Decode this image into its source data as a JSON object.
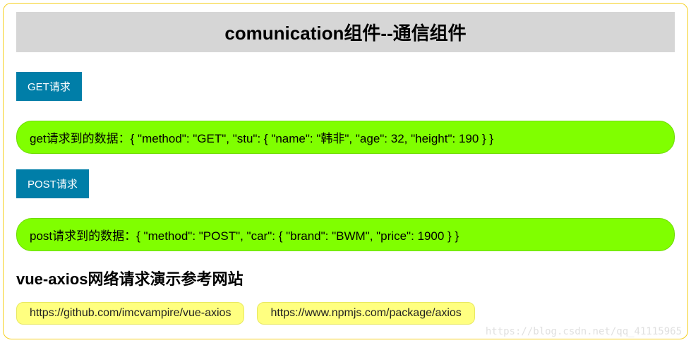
{
  "header": {
    "title": "comunication组件--通信组件"
  },
  "buttons": {
    "get_label": "GET请求",
    "post_label": "POST请求"
  },
  "data_boxes": {
    "get_prefix": "get请求到的数据：",
    "get_json": "{ \"method\": \"GET\", \"stu\": { \"name\": \"韩非\", \"age\": 32, \"height\": 190 } }",
    "post_prefix": "post请求到的数据：",
    "post_json": "{ \"method\": \"POST\", \"car\": { \"brand\": \"BWM\", \"price\": 1900 } }"
  },
  "subtitle": "vue-axios网络请求演示参考网站",
  "links": {
    "github": "https://github.com/imcvampire/vue-axios",
    "npm": "https://www.npmjs.com/package/axios"
  },
  "watermark": "https://blog.csdn.net/qq_41115965"
}
